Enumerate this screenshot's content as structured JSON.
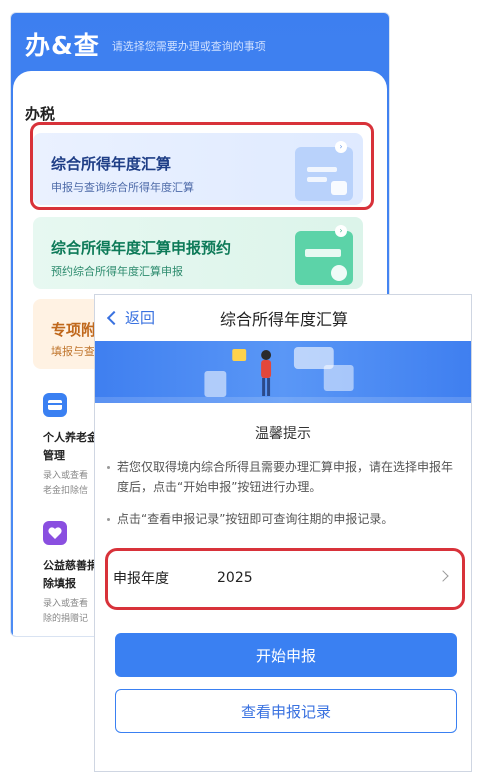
{
  "back_screen": {
    "header": {
      "title": "办&查",
      "subtitle": "请选择您需要办理或查询的事项"
    },
    "section_title": "办税",
    "cards": [
      {
        "title": "综合所得年度汇算",
        "desc": "申报与查询综合所得年度汇算"
      },
      {
        "title": "综合所得年度汇算申报预约",
        "desc": "预约综合所得年度汇算申报"
      },
      {
        "title": "专项附",
        "desc": "填报与查"
      }
    ],
    "tiles": [
      {
        "name_line1": "个人养老金",
        "name_line2": "管理",
        "desc_line1": "录入或查看",
        "desc_line2": "老金扣除信"
      },
      {
        "name_line1": "公益慈善捐",
        "name_line2": "除填报",
        "desc_line1": "录入或查看",
        "desc_line2": "除的捐赠记"
      }
    ]
  },
  "modal": {
    "nav": {
      "back_label": "返回",
      "title": "综合所得年度汇算"
    },
    "tips_title": "温馨提示",
    "tips": [
      "若您仅取得境内综合所得且需要办理汇算申报，请在选择申报年度后，点击“开始申报”按钮进行办理。",
      "点击“查看申报记录”按钮即可查询往期的申报记录。"
    ],
    "year_row": {
      "label": "申报年度",
      "value": "2025"
    },
    "primary_button": "开始申报",
    "secondary_button": "查看申报记录"
  },
  "colors": {
    "brand_blue": "#3a80f2",
    "highlight_red": "#d8323a",
    "green_card": "#0d7a58",
    "orange_card": "#c0681c"
  },
  "icons": [
    "chevron-left-icon",
    "chevron-right-icon",
    "pension-card-icon",
    "charity-heart-icon"
  ]
}
